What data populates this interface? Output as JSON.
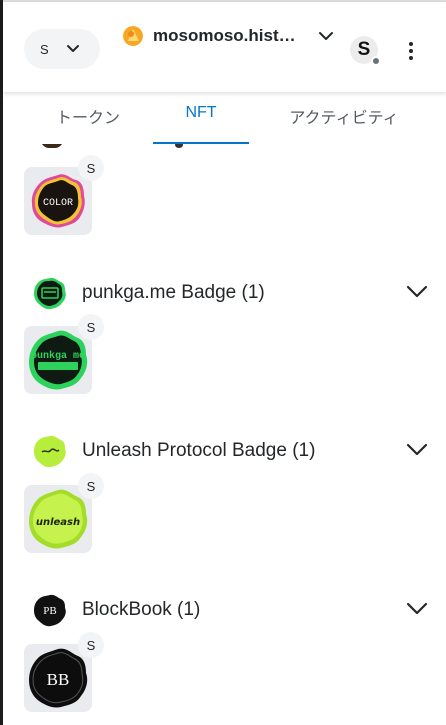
{
  "header": {
    "network_label": "S",
    "account_name": "mosomoso.hist…",
    "site_letter": "S"
  },
  "tabs": [
    {
      "label": "トークン",
      "active": false
    },
    {
      "label": "NFT",
      "active": true
    },
    {
      "label": "アクティビティ",
      "active": false
    }
  ],
  "colors": {
    "accent": "#0376c9",
    "pill_bg": "#f2f4f6",
    "card_bg": "#e9ebee",
    "neon_green": "#2cd25b",
    "lime": "#b7ee3c"
  },
  "collections": [
    {
      "name": "",
      "cards": [
        {
          "text": "COLOR",
          "badge": "S"
        }
      ]
    },
    {
      "name": "punkga.me Badge (1)",
      "cards": [
        {
          "text": "punkga me",
          "badge": "S"
        }
      ]
    },
    {
      "name": "Unleash Protocol Badge (1)",
      "cards": [
        {
          "text": "unleash",
          "badge": "S"
        }
      ]
    },
    {
      "name": "BlockBook (1)",
      "cards": [
        {
          "text": "BB",
          "badge": "S"
        }
      ]
    }
  ]
}
